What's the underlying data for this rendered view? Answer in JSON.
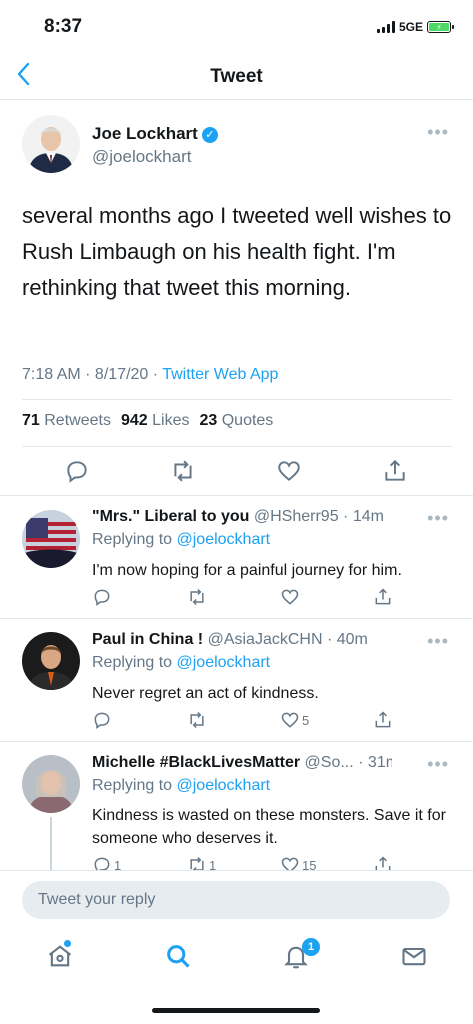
{
  "status_bar": {
    "time": "8:37",
    "network": "5GE"
  },
  "nav": {
    "title": "Tweet"
  },
  "main_tweet": {
    "author_name": "Joe Lockhart",
    "author_handle": "@joelockhart",
    "text": "several months ago I tweeted well wishes to Rush Limbaugh on his health fight.  I'm rethinking that tweet this morning.",
    "time": "7:18 AM · 8/17/20 · ",
    "source": "Twitter Web App",
    "retweets_count": "71",
    "retweets_label": "Retweets",
    "likes_count": "942",
    "likes_label": "Likes",
    "quotes_count": "23",
    "quotes_label": "Quotes"
  },
  "replies": [
    {
      "name": "\"Mrs.\" Liberal to you",
      "handle": "@HSherr95 · 14m",
      "replying_label": "Replying to ",
      "replying_to": "@joelockhart",
      "text": "I'm now hoping for a painful journey for him.",
      "reply_count": "",
      "retweet_count": "",
      "like_count": ""
    },
    {
      "name": "Paul in China !",
      "handle": "@AsiaJackCHN · 40m",
      "replying_label": "Replying to ",
      "replying_to": "@joelockhart",
      "text": "Never regret an act of kindness.",
      "reply_count": "",
      "retweet_count": "",
      "like_count": "5"
    },
    {
      "name": "Michelle #BlackLivesMatter",
      "handle": "@So... · 31m",
      "replying_label": "Replying to ",
      "replying_to": "@joelockhart",
      "text": "Kindness is wasted on these monsters. Save it for someone who deserves it.",
      "reply_count": "1",
      "retweet_count": "1",
      "like_count": "15"
    }
  ],
  "composer": {
    "placeholder": "Tweet your reply"
  },
  "tabbar": {
    "notifications_badge": "1"
  },
  "colors": {
    "accent": "#1da1f2",
    "text": "#14171a",
    "secondary": "#657786",
    "divider": "#e1e8ed"
  },
  "icons": [
    "back-chevron-icon",
    "verified-icon",
    "more-icon",
    "reply-icon",
    "retweet-icon",
    "like-icon",
    "share-icon",
    "home-icon",
    "search-icon",
    "bell-icon",
    "mail-icon"
  ]
}
